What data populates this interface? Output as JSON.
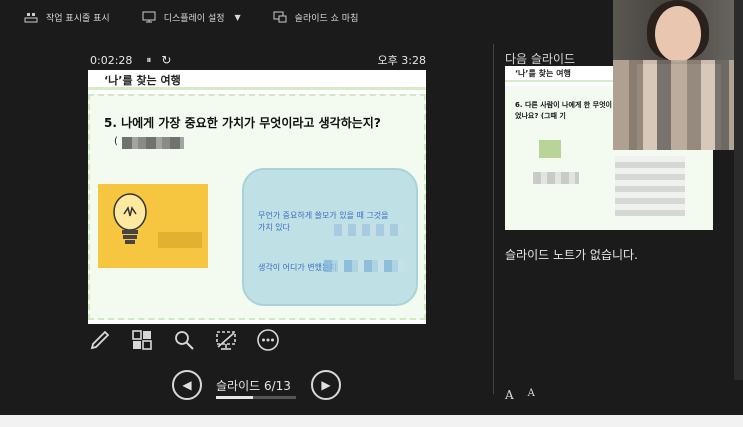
{
  "topbar": {
    "items": [
      {
        "label": "작업 표시줄 표시",
        "icon": "taskbar-icon"
      },
      {
        "label": "디스플레이 설정",
        "icon": "display-icon",
        "caret": "▼"
      },
      {
        "label": "슬라이드 쇼 마침",
        "icon": "end-show-icon"
      }
    ]
  },
  "presenter": {
    "elapsed_time": "0:02:28",
    "pause_glyph": "⏸",
    "reset_glyph": "↻",
    "clock": "오후 3:28"
  },
  "current_slide": {
    "header": "‘나’를 찾는 여행",
    "question": "5. 나에게 가장 중요한 가치가 무엇이라고 생각하는지?",
    "paren": "(",
    "speech_line1": "무언가 중요하게 쓸모가 있을 때 그것을",
    "speech_line1b": "가치 있다",
    "speech_line2": "생각이 어디가 변했는지"
  },
  "tools": [
    "pen-icon",
    "all-slides-icon",
    "zoom-icon",
    "black-screen-icon",
    "more-options-icon"
  ],
  "navigation": {
    "prev_glyph": "◀",
    "next_glyph": "▶",
    "counter": "슬라이드 6/13",
    "progress": 0.46
  },
  "next_panel": {
    "label": "다음 슬라이드",
    "slide_header": "‘나’를 찾는 여행",
    "slide_question": "6. 다른 사람이 나에게 한 무엇이었나요? (그때 기",
    "notes": "슬라이드 노트가 없습니다.",
    "font_increase": "A",
    "font_decrease": "A"
  },
  "colors": {
    "background": "#1b1b1b",
    "slide_band": "#d5ecc7",
    "speech_bubble": "#bfe0e4",
    "yellow_card": "#f6c640",
    "speech_text": "#3a6ec7"
  }
}
